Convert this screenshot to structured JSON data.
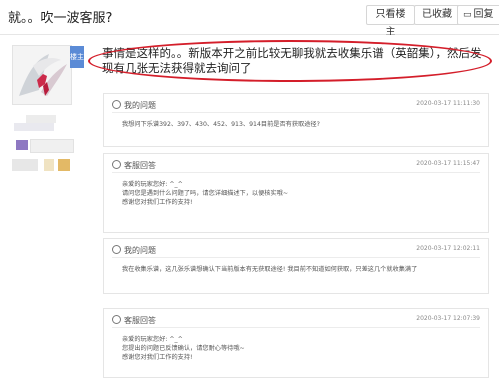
{
  "header": {
    "title": "就。。吹一波客服?",
    "btn_lz": "只看楼主",
    "btn_fav": "已收藏",
    "btn_reply": "回复"
  },
  "sidebar": {
    "badge": "楼主"
  },
  "post": {
    "text": "事情是这样的。。新版本开之前比较无聊我就去收集乐谱（英韶集），然后发现有几张无法获得就去询问了"
  },
  "cards": [
    {
      "heading": "我的问题",
      "date": "2020-03-17 11:11:30",
      "lines": [
        "我想问下乐谱392、397、430、452、913、914目前是否有获取途径?"
      ]
    },
    {
      "heading": "客服回答",
      "date": "2020-03-17 11:15:47",
      "lines": [
        "亲爱的玩家您好: ^_^",
        "        请问您是遇到什么问题了吗，请您详细描述下，以便核实哦~",
        "感谢您对我们工作的支持!"
      ]
    },
    {
      "heading": "我的问题",
      "date": "2020-03-17 12:02:11",
      "lines": [
        "我在收集乐谱，这几张乐谱想确认下当前版本有无获取途径! 我目前不知道如何获取，只差这几个就收集满了"
      ]
    },
    {
      "heading": "客服回答",
      "date": "2020-03-17 12:07:39",
      "lines": [
        "亲爱的玩家您好: ^_^",
        "        您提出的问题已反馈确认，请您耐心等待哦~",
        "感谢您对我们工作的支持!"
      ]
    }
  ]
}
